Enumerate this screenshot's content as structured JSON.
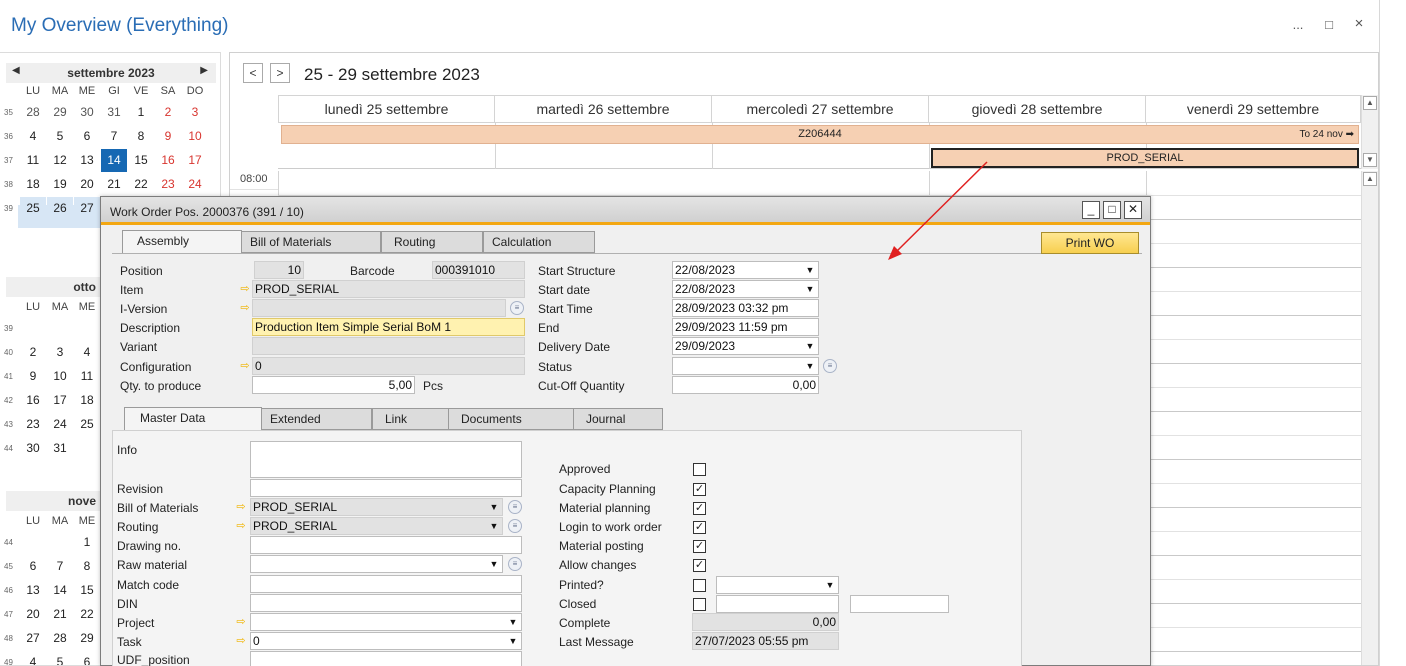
{
  "app": {
    "title": "My Overview (Everything)",
    "more_icon": "...",
    "maximize_icon": "□",
    "close_icon": "×"
  },
  "minical": {
    "sept": {
      "title": "settembre 2023",
      "prev": "◀",
      "next": "▶"
    },
    "dow": [
      "LU",
      "MA",
      "ME",
      "GI",
      "VE",
      "SA",
      "DO"
    ],
    "sept_weeks": [
      {
        "wk": "35",
        "days": [
          "28",
          "29",
          "30",
          "31",
          "1",
          "2",
          "3"
        ]
      },
      {
        "wk": "36",
        "days": [
          "4",
          "5",
          "6",
          "7",
          "8",
          "9",
          "10"
        ]
      },
      {
        "wk": "37",
        "days": [
          "11",
          "12",
          "13",
          "14",
          "15",
          "16",
          "17"
        ]
      },
      {
        "wk": "38",
        "days": [
          "18",
          "19",
          "20",
          "21",
          "22",
          "23",
          "24"
        ]
      },
      {
        "wk": "39",
        "days": [
          "25",
          "26",
          "27",
          "",
          "",
          "",
          ""
        ]
      }
    ],
    "oct": {
      "title": "otto"
    },
    "oct_dow": [
      "LU",
      "MA",
      "ME"
    ],
    "oct_weeks": [
      {
        "wk": "39",
        "days": [
          "",
          "",
          ""
        ]
      },
      {
        "wk": "40",
        "days": [
          "2",
          "3",
          "4"
        ]
      },
      {
        "wk": "41",
        "days": [
          "9",
          "10",
          "11"
        ]
      },
      {
        "wk": "42",
        "days": [
          "16",
          "17",
          "18"
        ]
      },
      {
        "wk": "43",
        "days": [
          "23",
          "24",
          "25"
        ]
      },
      {
        "wk": "44",
        "days": [
          "30",
          "31",
          ""
        ]
      }
    ],
    "nov": {
      "title": "nove"
    },
    "nov_dow": [
      "LU",
      "MA",
      "ME"
    ],
    "nov_weeks": [
      {
        "wk": "44",
        "days": [
          "",
          "",
          "1"
        ]
      },
      {
        "wk": "45",
        "days": [
          "6",
          "7",
          "8"
        ]
      },
      {
        "wk": "46",
        "days": [
          "13",
          "14",
          "15"
        ]
      },
      {
        "wk": "47",
        "days": [
          "20",
          "21",
          "22"
        ]
      },
      {
        "wk": "48",
        "days": [
          "27",
          "28",
          "29"
        ]
      },
      {
        "wk": "49",
        "days": [
          "4",
          "5",
          "6"
        ]
      }
    ]
  },
  "scheduler": {
    "prev": "<",
    "next": ">",
    "range": "25 - 29 settembre 2023",
    "days": [
      "lunedì 25 settembre",
      "martedì 26 settembre",
      "mercoledì 27 settembre",
      "giovedì 28 settembre",
      "venerdì 29 settembre"
    ],
    "event_z": "Z206444",
    "event_z_continue": "To 24 nov ➡",
    "event_prod": "PROD_SERIAL",
    "time_0800": "08:00"
  },
  "dialog": {
    "title": "Work Order Pos. 2000376 (391 / 10)",
    "tabs": [
      "Assembly",
      "Bill of Materials",
      "Routing",
      "Calculation"
    ],
    "print_wo": "Print WO",
    "left_fields": {
      "position_label": "Position",
      "position": "10",
      "barcode_label": "Barcode",
      "barcode": "000391010",
      "item_label": "Item",
      "item": "PROD_SERIAL",
      "iversion_label": "I-Version",
      "iversion": "",
      "description_label": "Description",
      "description": "Production Item Simple Serial BoM 1",
      "variant_label": "Variant",
      "variant": "",
      "configuration_label": "Configuration",
      "configuration": "0",
      "qty_label": "Qty. to produce",
      "qty": "5,00",
      "unit": "Pcs"
    },
    "right_fields": {
      "start_structure_label": "Start Structure",
      "start_structure": "22/08/2023",
      "start_date_label": "Start date",
      "start_date": "22/08/2023",
      "start_time_label": "Start Time",
      "start_time": "28/09/2023 03:32 pm",
      "end_label": "End",
      "end": "29/09/2023 11:59 pm",
      "delivery_label": "Delivery Date",
      "delivery": "29/09/2023",
      "status_label": "Status",
      "status": "",
      "cutoff_label": "Cut-Off Quantity",
      "cutoff": "0,00"
    },
    "subtabs": [
      "Master Data",
      "Extended",
      "Link",
      "Documents",
      "Journal"
    ],
    "master": {
      "info_label": "Info",
      "info": "",
      "revision_label": "Revision",
      "revision": "",
      "bom_label": "Bill of Materials",
      "bom": "PROD_SERIAL",
      "routing_label": "Routing",
      "routing": "PROD_SERIAL",
      "drawing_label": "Drawing no.",
      "drawing": "",
      "raw_label": "Raw material",
      "raw": "",
      "match_label": "Match code",
      "match": "",
      "din_label": "DIN",
      "din": "",
      "project_label": "Project",
      "project": "",
      "task_label": "Task",
      "task": "0",
      "udf_label": "UDF_position"
    },
    "flags": {
      "approved_label": "Approved",
      "approved": false,
      "capacity_label": "Capacity Planning",
      "capacity": true,
      "material_planning_label": "Material planning",
      "material_planning": true,
      "login_label": "Login to work order",
      "login": true,
      "material_posting_label": "Material posting",
      "material_posting": true,
      "allow_label": "Allow changes",
      "allow": true,
      "printed_label": "Printed?",
      "printed": false,
      "closed_label": "Closed",
      "closed": false,
      "complete_label": "Complete",
      "complete": "0,00",
      "last_message_label": "Last Message",
      "last_message": "27/07/2023 05:55 pm"
    }
  }
}
